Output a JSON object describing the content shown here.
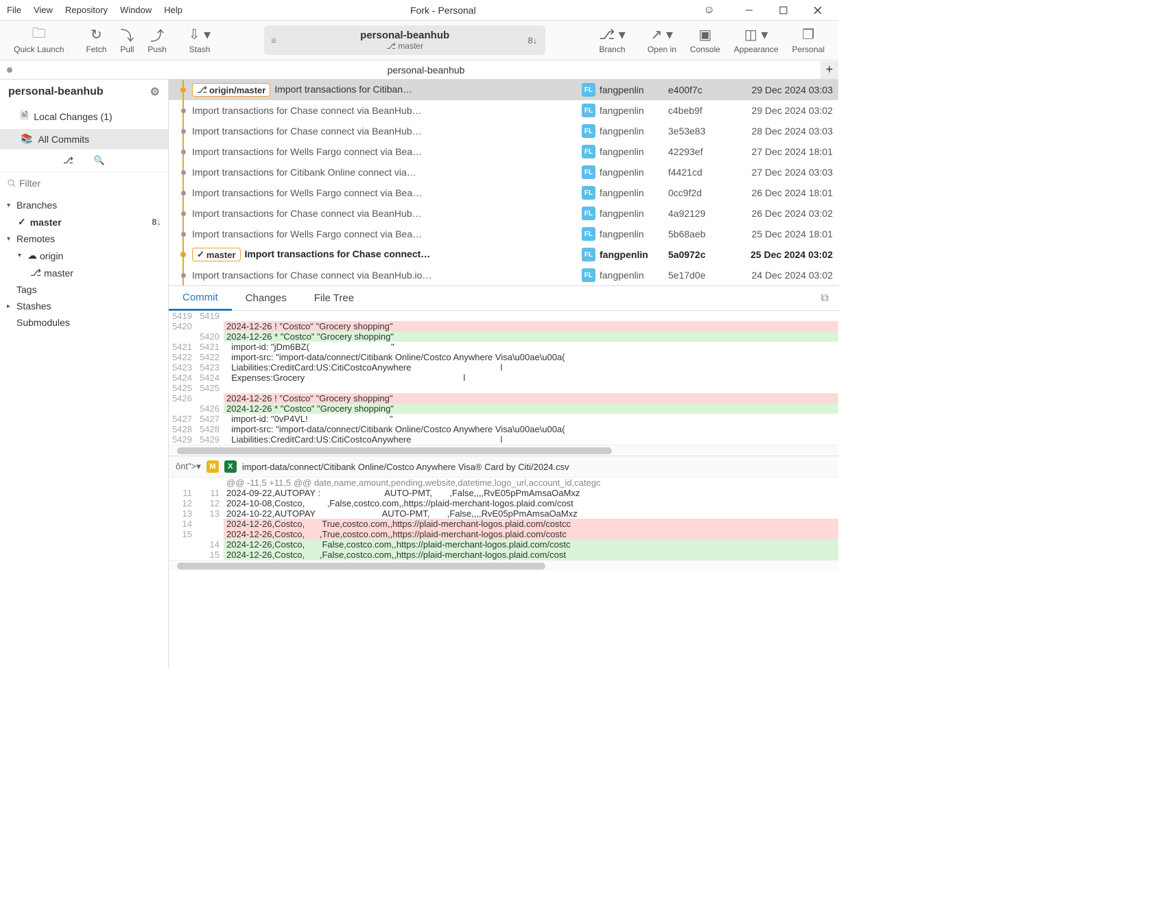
{
  "menu": [
    "File",
    "View",
    "Repository",
    "Window",
    "Help"
  ],
  "windowTitle": "Fork - Personal",
  "toolbar": {
    "quickLaunch": "Quick Launch",
    "fetch": "Fetch",
    "pull": "Pull",
    "push": "Push",
    "stash": "Stash",
    "branch": "Branch",
    "openIn": "Open in",
    "console": "Console",
    "appearance": "Appearance",
    "personal": "Personal"
  },
  "repoPill": {
    "name": "personal-beanhub",
    "branch": "master",
    "branchPrefix": "⎇",
    "count": "8↓"
  },
  "tabTitle": "personal-beanhub",
  "sidebar": {
    "repoName": "personal-beanhub",
    "localChanges": "Local Changes (1)",
    "allCommits": "All Commits",
    "filterPlaceholder": "Filter",
    "branches": "Branches",
    "master": "master",
    "masterCount": "8↓",
    "remotes": "Remotes",
    "origin": "origin",
    "originMaster": "master",
    "tags": "Tags",
    "stashes": "Stashes",
    "submodules": "Submodules"
  },
  "commits": [
    {
      "sel": true,
      "dot": "orange",
      "badge": "origin/master",
      "badgeIcon": "⎇",
      "msg": "Import transactions for Citiban…",
      "author": "fangpenlin",
      "hash": "e400f7c",
      "date": "29 Dec 2024 03:03"
    },
    {
      "msg": "Import transactions for Chase connect via BeanHub…",
      "author": "fangpenlin",
      "hash": "c4beb9f",
      "date": "29 Dec 2024 03:02"
    },
    {
      "msg": "Import transactions for Chase connect via BeanHub…",
      "author": "fangpenlin",
      "hash": "3e53e83",
      "date": "28 Dec 2024 03:03"
    },
    {
      "msg": "Import transactions for Wells Fargo connect via Bea…",
      "author": "fangpenlin",
      "hash": "42293ef",
      "date": "27 Dec 2024 18:01"
    },
    {
      "msg": "Import transactions for Citibank Online connect via…",
      "author": "fangpenlin",
      "hash": "f4421cd",
      "date": "27 Dec 2024 03:03"
    },
    {
      "msg": "Import transactions for Wells Fargo connect via Bea…",
      "author": "fangpenlin",
      "hash": "0cc9f2d",
      "date": "26 Dec 2024 18:01"
    },
    {
      "msg": "Import transactions for Chase connect via BeanHub…",
      "author": "fangpenlin",
      "hash": "4a92129",
      "date": "26 Dec 2024 03:02"
    },
    {
      "msg": "Import transactions for Wells Fargo connect via Bea…",
      "author": "fangpenlin",
      "hash": "5b68aeb",
      "date": "25 Dec 2024 18:01"
    },
    {
      "bold": true,
      "dot": "orange",
      "badge": "master",
      "badgeCheck": "✓",
      "msg": "Import transactions for Chase connect…",
      "author": "fangpenlin",
      "hash": "5a0972c",
      "date": "25 Dec 2024 03:02"
    },
    {
      "msg": "Import transactions for Chase connect via BeanHub.io…",
      "author": "fangpenlin",
      "hash": "5e17d0e",
      "date": "24 Dec 2024 03:02"
    }
  ],
  "authorInitials": "FL",
  "detailTabs": {
    "commit": "Commit",
    "changes": "Changes",
    "fileTree": "File Tree"
  },
  "diff1": [
    {
      "o": "5419",
      "n": "5419",
      "c": ""
    },
    {
      "o": "5420",
      "n": "",
      "t": "del",
      "c": "2024-12-26 ! \"Costco\" \"Grocery shopping\""
    },
    {
      "o": "",
      "n": "5420",
      "t": "add",
      "c": "2024-12-26 * \"Costco\" \"Grocery shopping\""
    },
    {
      "o": "5421",
      "n": "5421",
      "c": "  import-id: \"jDm6BZ(                                 \""
    },
    {
      "o": "5422",
      "n": "5422",
      "c": "  import-src: \"import-data/connect/Citibank Online/Costco Anywhere Visa\\u00ae\\u00a("
    },
    {
      "o": "5423",
      "n": "5423",
      "c": "  Liabilities:CreditCard:US:CitiCostcoAnywhere                                    l"
    },
    {
      "o": "5424",
      "n": "5424",
      "c": "  Expenses:Grocery                                                                l"
    },
    {
      "o": "5425",
      "n": "5425",
      "c": ""
    },
    {
      "o": "5426",
      "n": "",
      "t": "del",
      "c": "2024-12-26 ! \"Costco\" \"Grocery shopping\""
    },
    {
      "o": "",
      "n": "5426",
      "t": "add",
      "c": "2024-12-26 * \"Costco\" \"Grocery shopping\""
    },
    {
      "o": "5427",
      "n": "5427",
      "c": "  import-id: \"0vP4VL!                                 \""
    },
    {
      "o": "5428",
      "n": "5428",
      "c": "  import-src: \"import-data/connect/Citibank Online/Costco Anywhere Visa\\u00ae\\u00a("
    },
    {
      "o": "5429",
      "n": "5429",
      "c": "  Liabilities:CreditCard:US:CitiCostcoAnywhere                                    l"
    }
  ],
  "fileHeader": "import-data/connect/Citibank Online/Costco Anywhere Visa® Card by Citi/2024.csv",
  "diff2": [
    {
      "o": "",
      "n": "",
      "t": "hunk",
      "c": "@@ -11,5 +11,5 @@ date,name,amount,pending,website,datetime,logo_url,account_id,categc"
    },
    {
      "o": "11",
      "n": "11",
      "c": "2024-09-22,AUTOPAY :                          AUTO-PMT,       ,False,,,,RvE05pPmAmsaOaMxz"
    },
    {
      "o": "12",
      "n": "12",
      "c": "2024-10-08,Costco,         ,False,costco.com,,https://plaid-merchant-logos.plaid.com/cost"
    },
    {
      "o": "13",
      "n": "13",
      "c": "2024-10-22,AUTOPAY                           AUTO-PMT,       ,False,,,,RvE05pPmAmsaOaMxz"
    },
    {
      "o": "14",
      "n": "",
      "t": "del",
      "c": "2024-12-26,Costco,       True,costco.com,,https://plaid-merchant-logos.plaid.com/costcc"
    },
    {
      "o": "15",
      "n": "",
      "t": "del",
      "c": "2024-12-26,Costco,      ,True,costco.com,,https://plaid-merchant-logos.plaid.com/costc"
    },
    {
      "o": "",
      "n": "14",
      "t": "add",
      "c": "2024-12-26,Costco,       False,costco.com,,https://plaid-merchant-logos.plaid.com/costc"
    },
    {
      "o": "",
      "n": "15",
      "t": "add",
      "c": "2024-12-26,Costco,      ,False,costco.com,,https://plaid-merchant-logos.plaid.com/cost"
    }
  ]
}
